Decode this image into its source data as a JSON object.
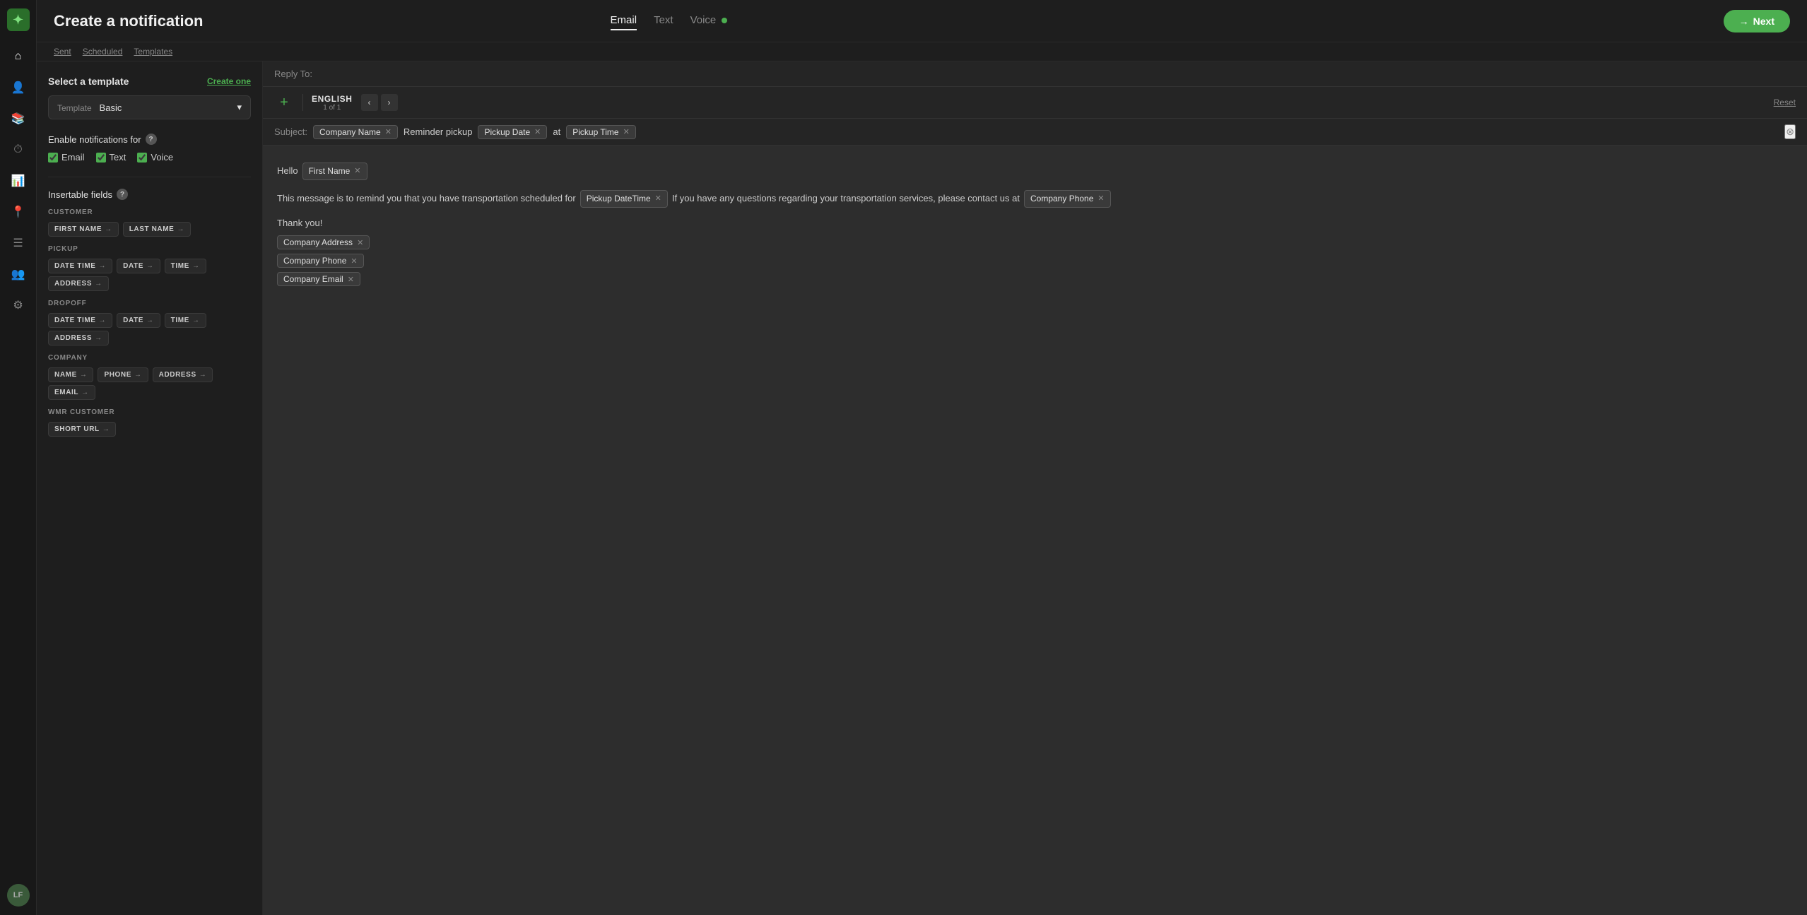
{
  "sidebar": {
    "logo": "✦",
    "avatar": "LF",
    "icons": [
      {
        "name": "home-icon",
        "symbol": "⌂"
      },
      {
        "name": "users-icon",
        "symbol": "👤"
      },
      {
        "name": "book-icon",
        "symbol": "📖"
      },
      {
        "name": "clock-icon",
        "symbol": "⏱"
      },
      {
        "name": "chart-icon",
        "symbol": "📊"
      },
      {
        "name": "location-icon",
        "symbol": "📍"
      },
      {
        "name": "list-icon",
        "symbol": "☰"
      },
      {
        "name": "group-icon",
        "symbol": "👥"
      },
      {
        "name": "settings-icon",
        "symbol": "⚙"
      }
    ]
  },
  "header": {
    "title": "Create a notification",
    "next_button": "Next",
    "next_arrow": "→"
  },
  "sub_nav": {
    "sent": "Sent",
    "scheduled": "Scheduled",
    "templates": "Templates"
  },
  "tabs": [
    {
      "id": "email",
      "label": "Email",
      "active": true
    },
    {
      "id": "text",
      "label": "Text",
      "active": false
    },
    {
      "id": "voice",
      "label": "Voice",
      "active": false,
      "has_dot": true
    }
  ],
  "left_panel": {
    "select_template": "Select a template",
    "create_one_label": "Create one",
    "template_label": "Template",
    "template_value": "Basic",
    "enable_title": "Enable notifications for",
    "checkboxes": [
      {
        "id": "email-cb",
        "label": "Email",
        "checked": true
      },
      {
        "id": "text-cb",
        "label": "Text",
        "checked": true
      },
      {
        "id": "voice-cb",
        "label": "Voice",
        "checked": true
      }
    ],
    "insertable_title": "Insertable fields",
    "groups": [
      {
        "label": "CUSTOMER",
        "fields": [
          {
            "label": "FIRST NAME",
            "has_arrow": true
          },
          {
            "label": "LAST NAME",
            "has_arrow": true
          }
        ]
      },
      {
        "label": "PICKUP",
        "fields": [
          {
            "label": "DATE TIME",
            "has_arrow": true
          },
          {
            "label": "DATE",
            "has_arrow": true
          },
          {
            "label": "TIME",
            "has_arrow": true
          },
          {
            "label": "ADDRESS",
            "has_arrow": true
          }
        ]
      },
      {
        "label": "DROPOFF",
        "fields": [
          {
            "label": "DATE TIME",
            "has_arrow": true
          },
          {
            "label": "DATE",
            "has_arrow": true
          },
          {
            "label": "TIME",
            "has_arrow": true
          },
          {
            "label": "ADDRESS",
            "has_arrow": true
          }
        ]
      },
      {
        "label": "COMPANY",
        "fields": [
          {
            "label": "NAME",
            "has_arrow": true
          },
          {
            "label": "PHONE",
            "has_arrow": true
          },
          {
            "label": "ADDRESS",
            "has_arrow": true
          },
          {
            "label": "EMAIL",
            "has_arrow": true
          }
        ]
      },
      {
        "label": "WMR CUSTOMER",
        "fields": [
          {
            "label": "SHORT URL",
            "has_arrow": true
          }
        ]
      }
    ]
  },
  "email_editor": {
    "reply_to_label": "Reply To:",
    "lang_name": "ENGLISH",
    "lang_count": "1 of 1",
    "reset_label": "Reset",
    "add_lang_symbol": "+",
    "prev_arrow": "‹",
    "next_arrow": "›",
    "subject_label": "Subject:",
    "subject_tags": [
      {
        "label": "Company Name"
      },
      {
        "static": "Reminder pickup"
      },
      {
        "label": "Pickup Date"
      },
      {
        "static": "at"
      },
      {
        "label": "Pickup Time"
      }
    ],
    "greeting_text": "Hello",
    "greeting_tag": "First Name",
    "body_prefix": "This message is to remind you that you have transportation scheduled for",
    "body_tag1": "Pickup DateTime",
    "body_suffix": "If you have any questions regarding your transportation services, please contact us at",
    "body_tag2": "Company Phone",
    "thank_you": "Thank you!",
    "signature_tags": [
      {
        "label": "Company Address"
      },
      {
        "label": "Company Phone"
      },
      {
        "label": "Company Email"
      }
    ]
  }
}
